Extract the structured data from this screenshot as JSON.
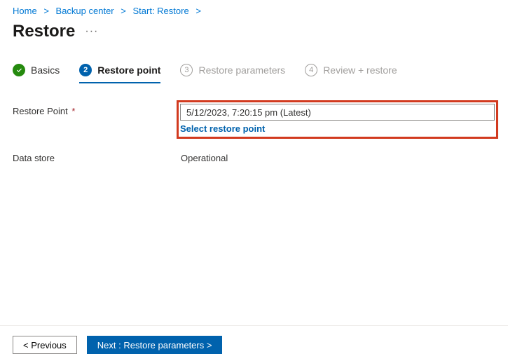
{
  "breadcrumb": {
    "items": [
      "Home",
      "Backup center",
      "Start: Restore"
    ]
  },
  "page": {
    "title": "Restore",
    "more": "···"
  },
  "tabs": {
    "t0": {
      "label": "Basics"
    },
    "t1": {
      "num": "2",
      "label": "Restore point"
    },
    "t2": {
      "num": "3",
      "label": "Restore parameters"
    },
    "t3": {
      "num": "4",
      "label": "Review + restore"
    }
  },
  "form": {
    "restorePoint": {
      "label": "Restore Point",
      "required": "*",
      "value": "5/12/2023, 7:20:15 pm (Latest)",
      "selectLink": "Select restore point"
    },
    "dataStore": {
      "label": "Data store",
      "value": "Operational"
    }
  },
  "footer": {
    "prev": "<  Previous",
    "next": "Next : Restore parameters  >"
  }
}
